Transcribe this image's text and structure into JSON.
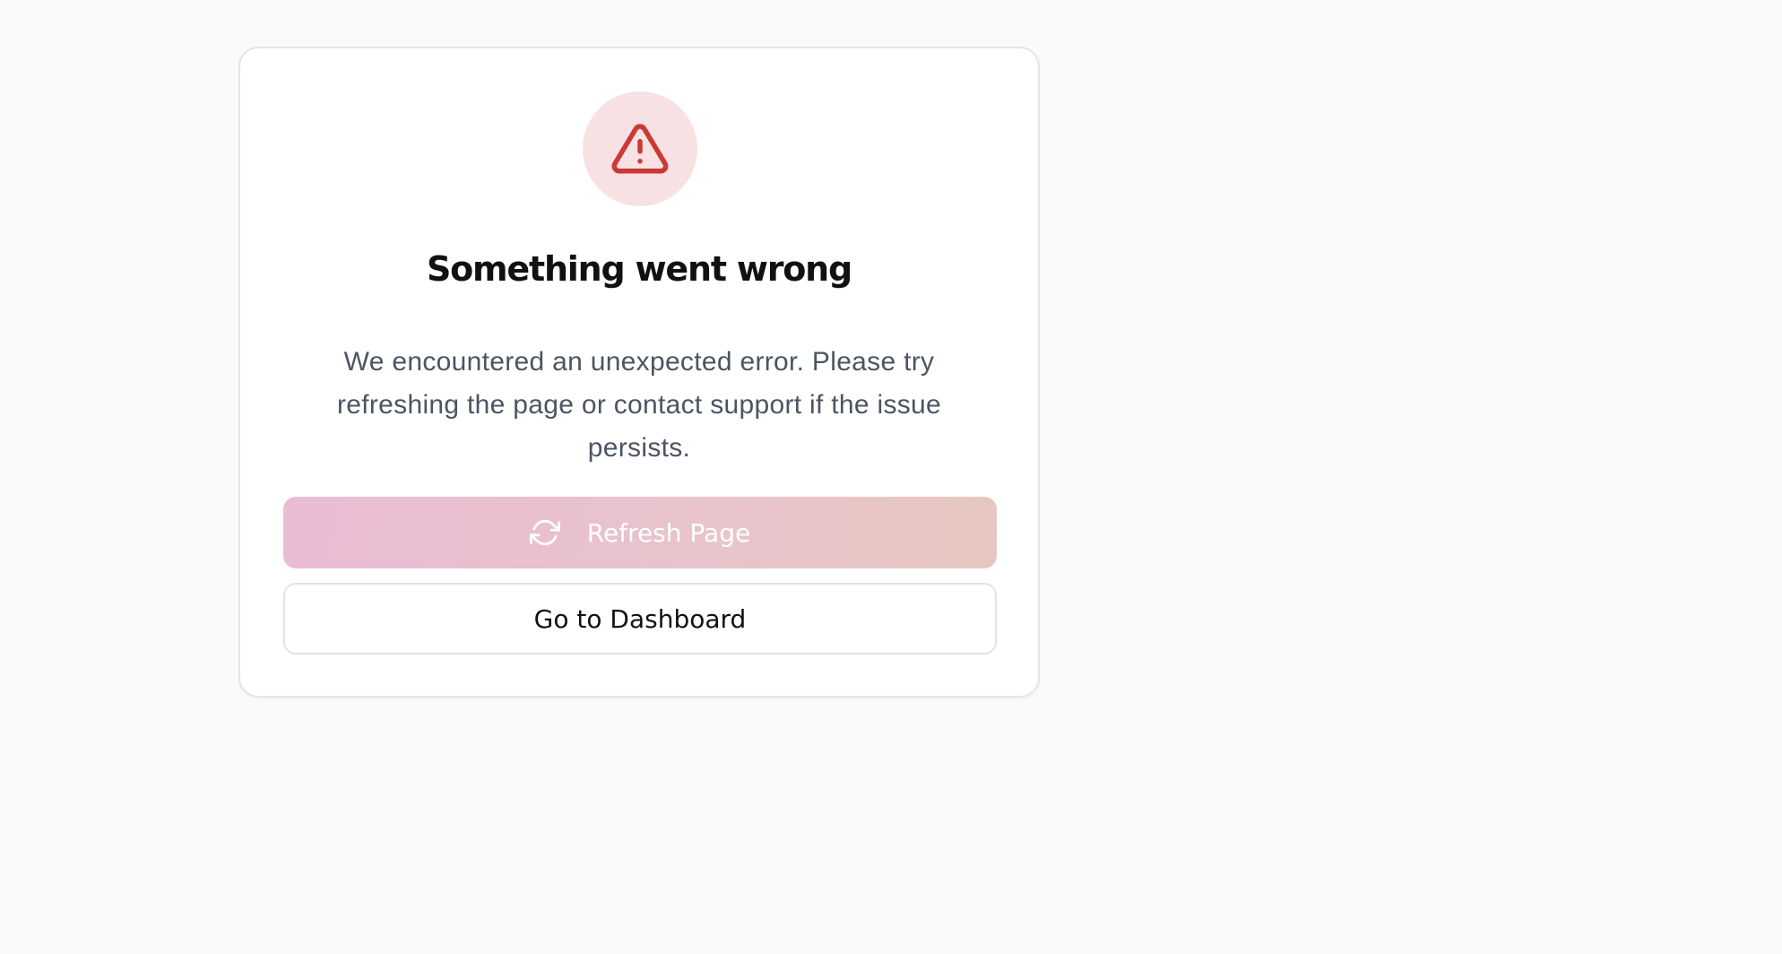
{
  "error_card": {
    "icon": "warning-triangle-icon",
    "title": "Something went wrong",
    "message": "We encountered an unexpected error. Please try refreshing the page or contact support if the issue persists."
  },
  "actions": {
    "refresh_label": "Refresh Page",
    "refresh_icon": "refresh-icon",
    "dashboard_label": "Go to Dashboard"
  },
  "colors": {
    "icon_red": "#c93a37",
    "icon_bg": "#f7e1e2",
    "primary_gradient_start": "#eabad3",
    "primary_gradient_end": "#e6c6bf",
    "message_text": "#4b5563"
  }
}
